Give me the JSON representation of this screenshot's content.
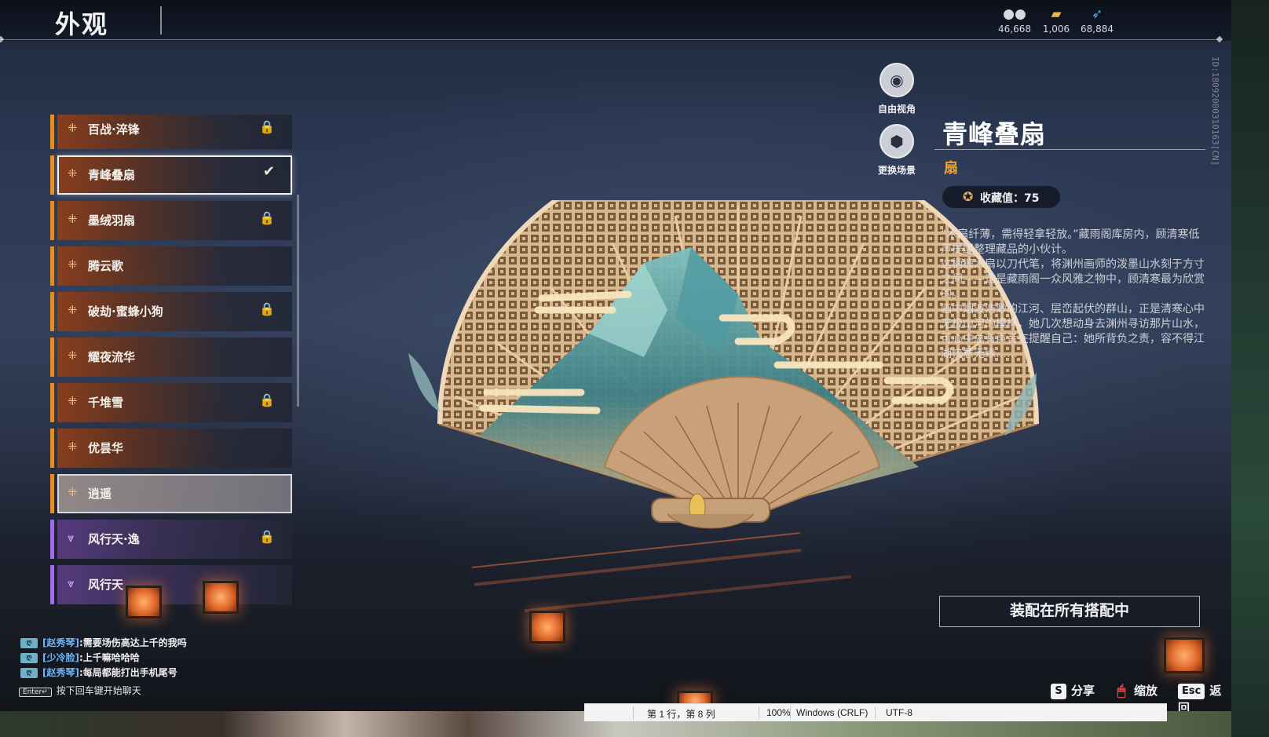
{
  "header": {
    "title": "外观",
    "currencies": [
      {
        "icon": "coin-icon",
        "value": "46,668"
      },
      {
        "icon": "ticket-icon",
        "value": "1,006"
      },
      {
        "icon": "feather-icon",
        "value": "68,884"
      }
    ],
    "side_id": "ID:1809200031016З[CN]"
  },
  "list": {
    "items": [
      {
        "name": "百战·淬锋",
        "rarity": "orange",
        "state": "locked"
      },
      {
        "name": "青峰叠扇",
        "rarity": "orange",
        "state": "equipped"
      },
      {
        "name": "墨绒羽扇",
        "rarity": "orange",
        "state": "locked"
      },
      {
        "name": "腾云歌",
        "rarity": "orange",
        "state": "owned"
      },
      {
        "name": "破劫·蜜蜂小狗",
        "rarity": "orange",
        "state": "locked"
      },
      {
        "name": "耀夜流华",
        "rarity": "orange",
        "state": "owned"
      },
      {
        "name": "千堆雪",
        "rarity": "orange",
        "state": "locked"
      },
      {
        "name": "优昙华",
        "rarity": "orange",
        "state": "owned"
      },
      {
        "name": "逍遥",
        "rarity": "orange",
        "state": "hover"
      },
      {
        "name": "风行天·逸",
        "rarity": "purple",
        "state": "locked"
      },
      {
        "name": "风行天",
        "rarity": "purple",
        "state": "owned"
      }
    ]
  },
  "camera": {
    "free_view": "自由视角",
    "change_scene": "更换场景"
  },
  "detail": {
    "title": "青峰叠扇",
    "type": "扇",
    "collect_label": "收藏值：75",
    "desc": [
      "“木扇纤薄，需得轻拿轻放。”藏雨阁库房内，顾清寒低声提醒整理藏品的小伙计。",
      "这柄檀木扇以刀代笔，将渊州画师的泼墨山水刻于方寸之间——这是藏雨阁一众风雅之物中，顾清寒最为欣赏的。",
      "画中烟波浩渺的江河、层峦起伏的群山，正是清寒心中无极山河的模样，她几次想动身去渊州寻访那片山水，可心中总有声音在提醒自己：她所背负之责，容不得江湖快意无缘……"
    ],
    "equip_button": "装配在所有搭配中"
  },
  "chat": {
    "lines": [
      {
        "who": "[赵秀琴]",
        "msg": "需要场伤高达上千的我吗"
      },
      {
        "who": "[少冷脸]",
        "msg": "上千嘛哈哈哈"
      },
      {
        "who": "[赵秀琴]",
        "msg": "每局都能打出手机尾号"
      }
    ],
    "enter_key": "Enter↵",
    "enter_hint": "按下回车键开始聊天"
  },
  "hotkeys": [
    {
      "key": "S",
      "label": "分享"
    },
    {
      "key": "🖱",
      "label": "缩放"
    },
    {
      "key": "Esc",
      "label": "返回"
    }
  ],
  "statusbar": {
    "position": "第 1 行，第 8 列",
    "zoom": "100%",
    "line_ending": "Windows (CRLF)",
    "encoding": "UTF-8"
  },
  "colors": {
    "accent_orange": "#e08d2a",
    "accent_purple": "#9c6ee6",
    "type_gold": "#e9a33a",
    "chat_name_blue": "#6cb6ff"
  }
}
